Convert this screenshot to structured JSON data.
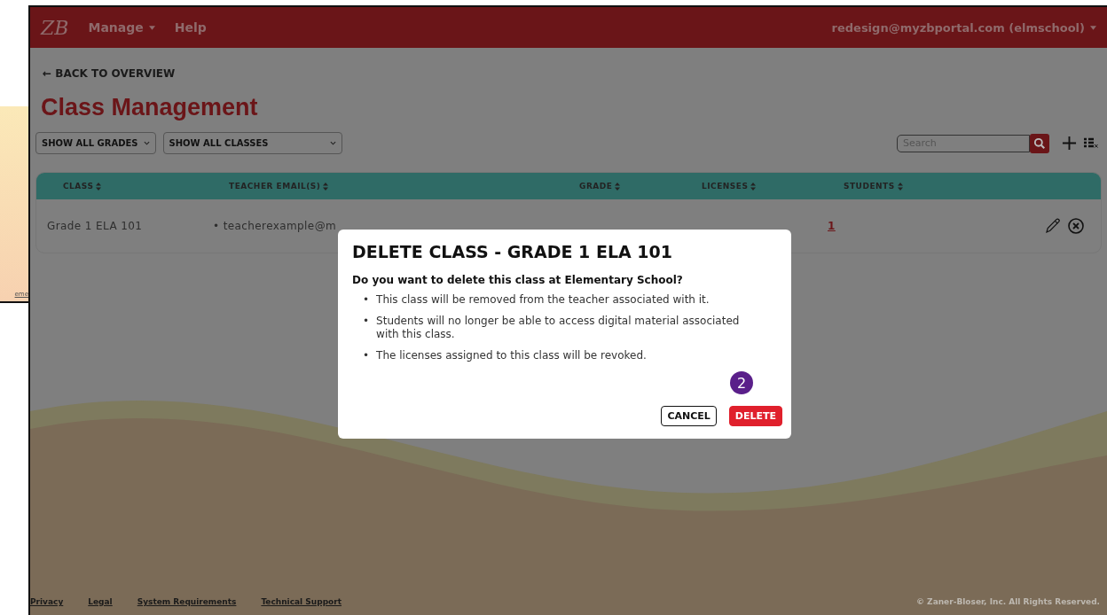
{
  "background_window": {
    "link_fragment": "eme"
  },
  "nav": {
    "logo": "ZB",
    "menu": [
      {
        "label": "Manage",
        "has_dropdown": true
      },
      {
        "label": "Help",
        "has_dropdown": false
      }
    ],
    "account": "redesign@myzbportal.com (elmschool)"
  },
  "back_link": "← BACK TO OVERVIEW",
  "title": "Class Management",
  "filters": [
    {
      "value": "SHOW ALL GRADES"
    },
    {
      "value": "SHOW ALL CLASSES"
    }
  ],
  "search": {
    "placeholder": "Search"
  },
  "table": {
    "columns": [
      "CLASS",
      "TEACHER EMAIL(S)",
      "GRADE",
      "LICENSES",
      "STUDENTS"
    ],
    "rows": [
      {
        "class": "Grade 1 ELA 101",
        "teacher_email": "• teacherexample@m",
        "students": "1"
      }
    ]
  },
  "dialog": {
    "title": "DELETE CLASS - GRADE 1 ELA 101",
    "question": "Do you want to delete this class at Elementary School?",
    "points": [
      {
        "marker": "•",
        "text": "This class will be removed from the teacher associated with it."
      },
      {
        "marker": "•",
        "text": "Students will no longer be able to access digital material associated with this class."
      },
      {
        "marker": "•",
        "text": "The licenses assigned to this class will be revoked."
      }
    ],
    "step_badge": "2",
    "buttons": [
      {
        "label": "CANCEL",
        "kind": "secondary"
      },
      {
        "label": "DELETE",
        "kind": "danger"
      }
    ]
  },
  "footer": {
    "links": [
      "Privacy",
      "Legal",
      "System Requirements",
      "Technical Support"
    ],
    "copyright": "© Zaner-Bloser, Inc. All Rights Reserved."
  }
}
